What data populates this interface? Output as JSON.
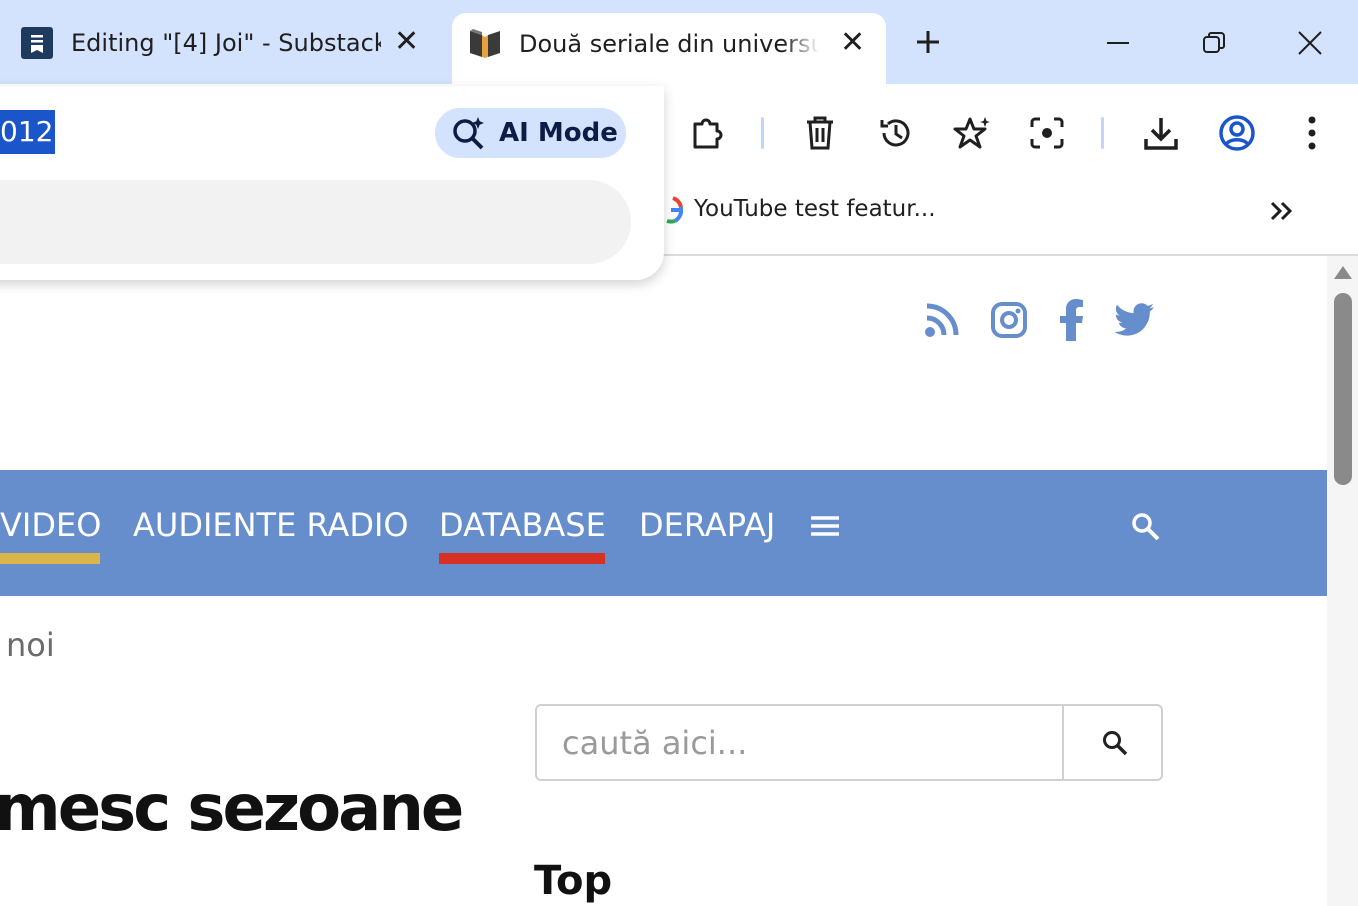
{
  "browser": {
    "tabs": [
      {
        "title": "Editing \"[4] Joi\" - Substack",
        "favicon": "substack-icon",
        "active": false
      },
      {
        "title": "Două seriale din universul C",
        "favicon": "book-logo-icon",
        "active": true
      }
    ],
    "new_tab_icon": "plus-icon",
    "window_controls": [
      "minimize-icon",
      "restore-icon",
      "close-icon"
    ]
  },
  "omnibox": {
    "selected_text": "012",
    "ai_mode_label": "AI Mode",
    "ai_mode_icon": "sparkle-search-icon"
  },
  "toolbar": {
    "icons": [
      "puzzle-icon",
      "trash-icon",
      "history-icon",
      "star-sparkle-icon",
      "camera-scan-icon",
      "download-icon",
      "profile-icon",
      "more-vert-icon"
    ]
  },
  "bookmarks": {
    "items": [
      {
        "label": "YouTube test featur...",
        "icon": "google-icon"
      }
    ],
    "overflow_icon": "chevron-double-right-icon"
  },
  "page": {
    "social_icons": [
      "rss-icon",
      "instagram-icon",
      "facebook-icon",
      "twitter-icon"
    ],
    "nav": {
      "items": [
        {
          "label": "VIDEO",
          "underline": "#d9b54a"
        },
        {
          "label": "AUDIENTE RADIO",
          "underline": ""
        },
        {
          "label": "DATABASE",
          "underline": "#d93025"
        },
        {
          "label": "DERAPAJ",
          "underline": ""
        }
      ],
      "menu_icon": "hamburger-icon",
      "search_icon": "search-icon",
      "background": "#668ecd"
    },
    "breadcrumb": "noi",
    "search": {
      "placeholder": "caută aici..."
    },
    "headline": "mesc sezoane",
    "sidebar_heading": "Top"
  }
}
